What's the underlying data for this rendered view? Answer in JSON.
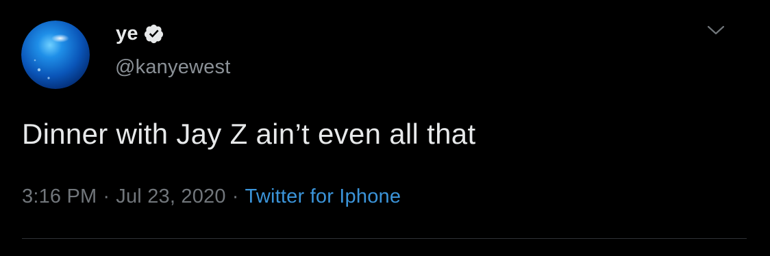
{
  "tweet": {
    "author": {
      "display_name": "ye",
      "handle": "@kanyewest",
      "verified": true,
      "avatar_icon": "blue-orb-avatar",
      "verified_icon": "verified-check-icon"
    },
    "menu_icon": "chevron-down-icon",
    "text": "Dinner with Jay Z ain’t even all that",
    "time": "3:16 PM",
    "separator": "·",
    "date": "Jul 23, 2020",
    "source": "Twitter for Iphone"
  },
  "colors": {
    "background": "#000000",
    "primary_text": "#e7e9ea",
    "secondary_text": "#71767b",
    "link": "#3b94d9",
    "divider": "#2f3336"
  }
}
